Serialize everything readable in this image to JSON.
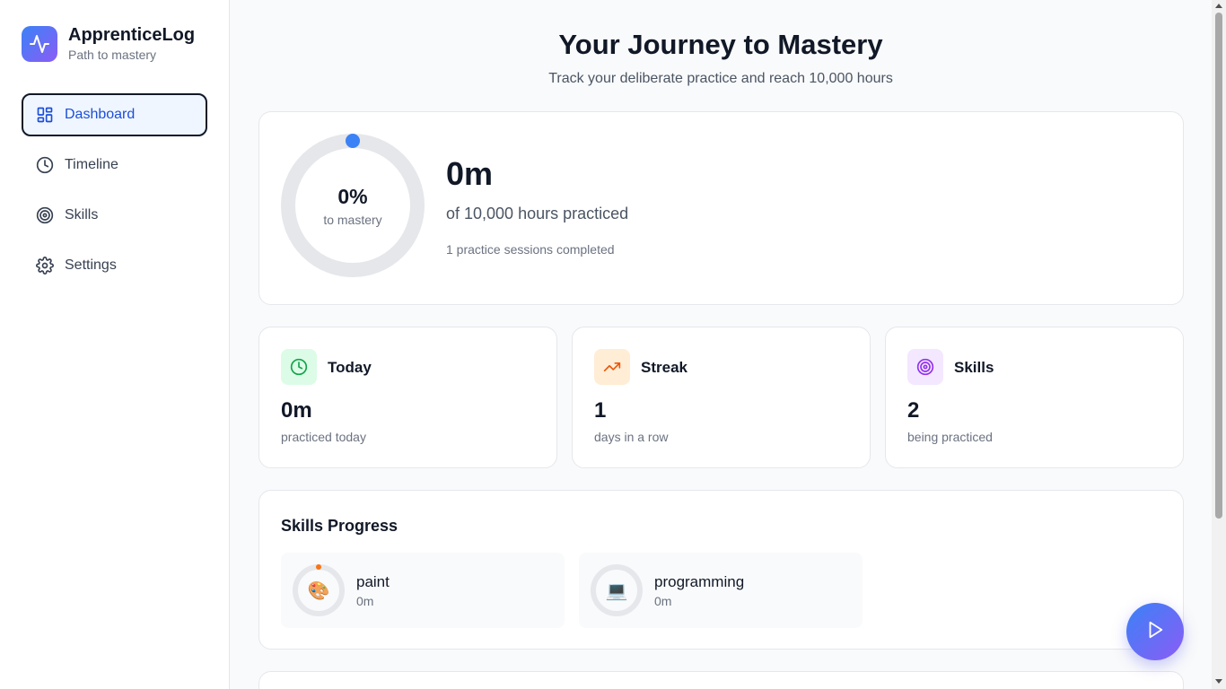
{
  "app": {
    "title": "ApprenticeLog",
    "subtitle": "Path to mastery",
    "logo_icon": "activity-icon"
  },
  "sidebar": {
    "items": [
      {
        "label": "Dashboard",
        "icon": "dashboard-icon",
        "active": true
      },
      {
        "label": "Timeline",
        "icon": "clock-icon",
        "active": false
      },
      {
        "label": "Skills",
        "icon": "target-icon",
        "active": false
      },
      {
        "label": "Settings",
        "icon": "gear-icon",
        "active": false
      }
    ]
  },
  "header": {
    "title": "Your Journey to Mastery",
    "subtitle": "Track your deliberate practice and reach 10,000 hours"
  },
  "mastery": {
    "percent_label": "0%",
    "percent_caption": "to mastery",
    "progress_fraction": 0,
    "total_time": "0m",
    "of_hours": "of 10,000 hours practiced",
    "sessions": "1 practice sessions completed"
  },
  "stats": [
    {
      "title": "Today",
      "value": "0m",
      "caption": "practiced today",
      "icon": "clock-icon",
      "color": "#16a34a",
      "bg": "#dcfce7"
    },
    {
      "title": "Streak",
      "value": "1",
      "caption": "days in a row",
      "icon": "trending-up-icon",
      "color": "#ea580c",
      "bg": "#ffedd5"
    },
    {
      "title": "Skills",
      "value": "2",
      "caption": "being practiced",
      "icon": "target-icon",
      "color": "#9333ea",
      "bg": "#f3e8ff"
    }
  ],
  "skills_progress": {
    "title": "Skills Progress",
    "items": [
      {
        "name": "paint",
        "time": "0m",
        "emoji": "🎨",
        "accent": "#f97316"
      },
      {
        "name": "programming",
        "time": "0m",
        "emoji": "💻",
        "accent": "#9ca3af"
      }
    ]
  },
  "fab": {
    "icon": "play-icon"
  },
  "colors": {
    "accent": "#3b82f6",
    "brand_gradient_start": "#3b82f6",
    "brand_gradient_end": "#8b5cf6",
    "active_nav_bg": "#eff6ff"
  }
}
